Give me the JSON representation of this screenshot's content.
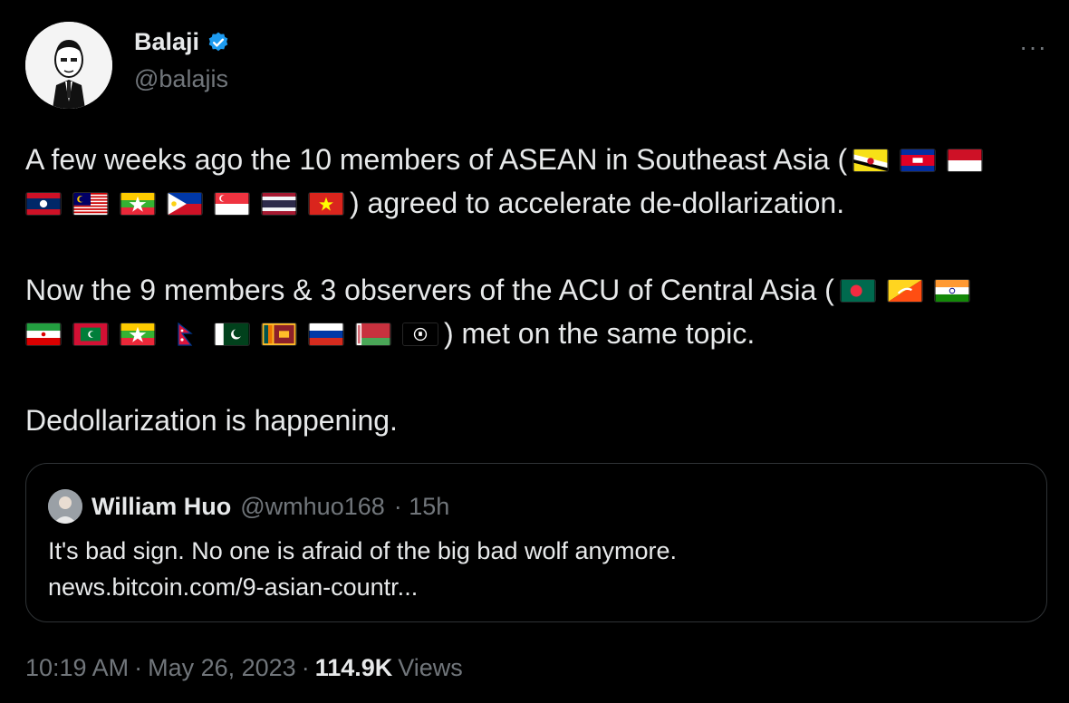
{
  "author": {
    "name": "Balaji",
    "handle": "@balajis"
  },
  "more_label": "···",
  "tweet": {
    "p1_start": "A few weeks ago the 10 members of ASEAN in Southeast Asia (",
    "p1_end": ") agreed to accelerate de-dollarization.",
    "p1_flags": [
      "brunei-flag",
      "cambodia-flag",
      "indonesia-flag",
      "laos-flag",
      "malaysia-flag",
      "myanmar-flag",
      "philippines-flag",
      "singapore-flag",
      "thailand-flag",
      "vietnam-flag"
    ],
    "p2_start": "Now the 9 members & 3 observers of the ACU of Central Asia (",
    "p2_end": ") met on the same topic.",
    "p2_flags": [
      "bangladesh-flag",
      "bhutan-flag",
      "india-flag",
      "iran-flag",
      "maldives-flag",
      "myanmar-flag",
      "nepal-flag",
      "pakistan-flag",
      "sri-lanka-flag",
      "russia-flag",
      "belarus-flag",
      "afghanistan-flag"
    ],
    "p3": "Dedollarization is happening."
  },
  "quote": {
    "name": "William Huo",
    "handle": "@wmhuo168",
    "time": "· 15h",
    "line1": "It's bad sign. No one is afraid of the big bad wolf anymore.",
    "line2": "news.bitcoin.com/9-asian-countr..."
  },
  "footer": {
    "time": "10:19 AM",
    "sep1": "·",
    "date": "May 26, 2023",
    "sep2": "·",
    "views_count": "114.9K",
    "views_label": "Views"
  },
  "colors": {
    "background": "#000000",
    "text": "#e7e9ea",
    "muted": "#71767b",
    "verified": "#1d9bf0",
    "border": "#2f3336"
  }
}
